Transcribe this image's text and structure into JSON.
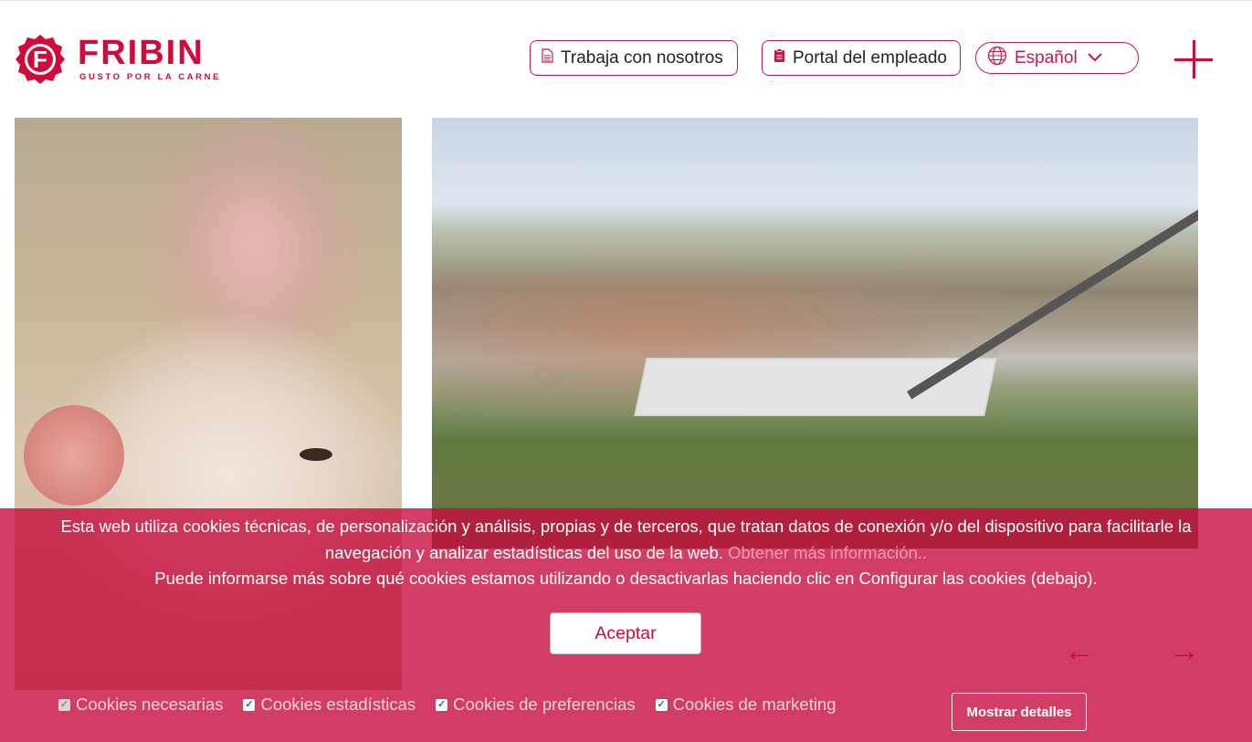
{
  "header": {
    "brand_name": "FRIBIN",
    "brand_tagline": "GUSTO POR LA CARNE",
    "logo_letter": "F",
    "work_with_us_label": "Trabaja con nosotros",
    "employee_portal_label": "Portal del empleado",
    "language_label": "Español",
    "menu_icon": "plus-icon"
  },
  "carousel": {
    "prev_arrow": "←",
    "next_arrow": "→"
  },
  "cookies": {
    "text_1": "Esta web utiliza cookies técnicas, de personalización y análisis, propias y de terceros, que tratan datos de conexión y/o del dispositivo para facilitarle la navegación y analizar estadísticas del uso de la web.",
    "more_info_link": "Obtener más información..",
    "text_2": "Puede informarse más sobre qué cookies estamos utilizando o desactivarlas haciendo clic en Configurar las cookies (debajo).",
    "accept_label": "Aceptar",
    "options": [
      {
        "label": "Cookies necesarias",
        "checked": true,
        "disabled": true
      },
      {
        "label": "Cookies estadísticas",
        "checked": true,
        "disabled": false
      },
      {
        "label": "Cookies de preferencias",
        "checked": true,
        "disabled": false
      },
      {
        "label": "Cookies de marketing",
        "checked": true,
        "disabled": false
      }
    ],
    "details_label": "Mostrar detalles"
  },
  "colors": {
    "brand_red": "#d20a3c",
    "banner_overlay": "#c50d3d"
  }
}
